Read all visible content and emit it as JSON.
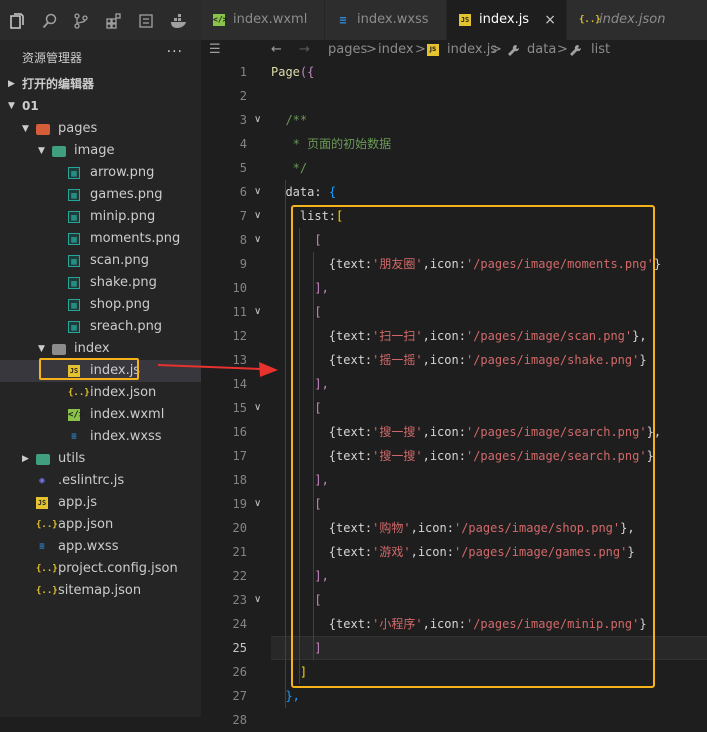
{
  "activity_bar": {
    "icons": [
      "files-icon",
      "search-icon",
      "source-control-icon",
      "extensions-icon",
      "debug-icon",
      "docker-icon"
    ]
  },
  "explorer": {
    "title": "资源管理器",
    "more": "···",
    "sections": [
      {
        "label": "打开的编辑器",
        "collapsed": true
      },
      {
        "label": "01",
        "collapsed": false
      }
    ],
    "tree": [
      {
        "name": "pages",
        "type": "folder",
        "depth": 1,
        "open": true
      },
      {
        "name": "image",
        "type": "folder-g",
        "depth": 2,
        "open": true
      },
      {
        "name": "arrow.png",
        "type": "img",
        "depth": 3
      },
      {
        "name": "games.png",
        "type": "img",
        "depth": 3
      },
      {
        "name": "minip.png",
        "type": "img",
        "depth": 3
      },
      {
        "name": "moments.png",
        "type": "img",
        "depth": 3
      },
      {
        "name": "scan.png",
        "type": "img",
        "depth": 3
      },
      {
        "name": "shake.png",
        "type": "img",
        "depth": 3
      },
      {
        "name": "shop.png",
        "type": "img",
        "depth": 3
      },
      {
        "name": "sreach.png",
        "type": "img",
        "depth": 3
      },
      {
        "name": "index",
        "type": "folder-p",
        "depth": 2,
        "open": true
      },
      {
        "name": "index.js",
        "type": "js",
        "depth": 3,
        "selected": true
      },
      {
        "name": "index.json",
        "type": "json",
        "depth": 3
      },
      {
        "name": "index.wxml",
        "type": "wxml",
        "depth": 3
      },
      {
        "name": "index.wxss",
        "type": "wxss",
        "depth": 3
      },
      {
        "name": "utils",
        "type": "folder-g",
        "depth": 1,
        "open": false
      },
      {
        "name": ".eslintrc.js",
        "type": "eslint",
        "depth": 1
      },
      {
        "name": "app.js",
        "type": "js",
        "depth": 1
      },
      {
        "name": "app.json",
        "type": "json",
        "depth": 1
      },
      {
        "name": "app.wxss",
        "type": "wxss",
        "depth": 1
      },
      {
        "name": "project.config.json",
        "type": "json",
        "depth": 1
      },
      {
        "name": "sitemap.json",
        "type": "json",
        "depth": 1
      }
    ]
  },
  "tabs": [
    {
      "label": "index.wxml",
      "icon": "wxml",
      "active": false
    },
    {
      "label": "index.wxss",
      "icon": "wxss",
      "active": false
    },
    {
      "label": "index.js",
      "icon": "js",
      "active": true,
      "close": "×"
    },
    {
      "label": "index.json",
      "icon": "json",
      "active": false,
      "italic": true
    }
  ],
  "breadcrumb": {
    "parts": [
      "pages",
      ">",
      "index",
      ">",
      "index.js",
      ">",
      "data",
      ">",
      "list"
    ]
  },
  "editor": {
    "current_line": 25,
    "lines": [
      {
        "n": "1",
        "fold": "",
        "tokens": [
          [
            "Page",
            "k-y"
          ],
          [
            "({",
            "k-p"
          ]
        ]
      },
      {
        "n": "2",
        "fold": "",
        "tokens": []
      },
      {
        "n": "3",
        "fold": "v",
        "tokens": [
          [
            "  /**",
            "k-g"
          ]
        ]
      },
      {
        "n": "4",
        "fold": "",
        "tokens": [
          [
            "   * 页面的初始数据",
            "k-g"
          ]
        ]
      },
      {
        "n": "5",
        "fold": "",
        "tokens": [
          [
            "   */",
            "k-g"
          ]
        ]
      },
      {
        "n": "6",
        "fold": "v",
        "tokens": [
          [
            "  data",
            "k-w"
          ],
          [
            ": ",
            "k-w"
          ],
          [
            "{",
            "k-b"
          ]
        ]
      },
      {
        "n": "7",
        "fold": "v",
        "tokens": [
          [
            "    list",
            "k-w"
          ],
          [
            ":",
            "k-w"
          ],
          [
            "[",
            "k-o"
          ]
        ]
      },
      {
        "n": "8",
        "fold": "v",
        "tokens": [
          [
            "      [",
            "k-p"
          ]
        ]
      },
      {
        "n": "9",
        "fold": "",
        "tokens": [
          [
            "        {text:",
            "k-w"
          ],
          [
            "'朋友圈'",
            "k-r"
          ],
          [
            ",icon:",
            "k-w"
          ],
          [
            "'/pages/image/moments.png'",
            "k-r"
          ],
          [
            "}",
            "k-w"
          ]
        ]
      },
      {
        "n": "10",
        "fold": "",
        "tokens": [
          [
            "      ],",
            "k-p"
          ]
        ]
      },
      {
        "n": "11",
        "fold": "v",
        "tokens": [
          [
            "      [",
            "k-p"
          ]
        ]
      },
      {
        "n": "12",
        "fold": "",
        "tokens": [
          [
            "        {text:",
            "k-w"
          ],
          [
            "'扫一扫'",
            "k-r"
          ],
          [
            ",icon:",
            "k-w"
          ],
          [
            "'/pages/image/scan.png'",
            "k-r"
          ],
          [
            "},",
            "k-w"
          ]
        ]
      },
      {
        "n": "13",
        "fold": "",
        "tokens": [
          [
            "        {text:",
            "k-w"
          ],
          [
            "'摇一摇'",
            "k-r"
          ],
          [
            ",icon:",
            "k-w"
          ],
          [
            "'/pages/image/shake.png'",
            "k-r"
          ],
          [
            "}",
            "k-w"
          ]
        ]
      },
      {
        "n": "14",
        "fold": "",
        "tokens": [
          [
            "      ],",
            "k-p"
          ]
        ]
      },
      {
        "n": "15",
        "fold": "v",
        "tokens": [
          [
            "      [",
            "k-p"
          ]
        ]
      },
      {
        "n": "16",
        "fold": "",
        "tokens": [
          [
            "        {text:",
            "k-w"
          ],
          [
            "'搜一搜'",
            "k-r"
          ],
          [
            ",icon:",
            "k-w"
          ],
          [
            "'/pages/image/search.png'",
            "k-r"
          ],
          [
            "},",
            "k-w"
          ]
        ]
      },
      {
        "n": "17",
        "fold": "",
        "tokens": [
          [
            "        {text:",
            "k-w"
          ],
          [
            "'搜一搜'",
            "k-r"
          ],
          [
            ",icon:",
            "k-w"
          ],
          [
            "'/pages/image/search.png'",
            "k-r"
          ],
          [
            "}",
            "k-w"
          ]
        ]
      },
      {
        "n": "18",
        "fold": "",
        "tokens": [
          [
            "      ],",
            "k-p"
          ]
        ]
      },
      {
        "n": "19",
        "fold": "v",
        "tokens": [
          [
            "      [",
            "k-p"
          ]
        ]
      },
      {
        "n": "20",
        "fold": "",
        "tokens": [
          [
            "        {text:",
            "k-w"
          ],
          [
            "'购物'",
            "k-r"
          ],
          [
            ",icon:",
            "k-w"
          ],
          [
            "'/pages/image/shop.png'",
            "k-r"
          ],
          [
            "},",
            "k-w"
          ]
        ]
      },
      {
        "n": "21",
        "fold": "",
        "tokens": [
          [
            "        {text:",
            "k-w"
          ],
          [
            "'游戏'",
            "k-r"
          ],
          [
            ",icon:",
            "k-w"
          ],
          [
            "'/pages/image/games.png'",
            "k-r"
          ],
          [
            "}",
            "k-w"
          ]
        ]
      },
      {
        "n": "22",
        "fold": "",
        "tokens": [
          [
            "      ],",
            "k-p"
          ]
        ]
      },
      {
        "n": "23",
        "fold": "v",
        "tokens": [
          [
            "      [",
            "k-p"
          ]
        ]
      },
      {
        "n": "24",
        "fold": "",
        "tokens": [
          [
            "        {text:",
            "k-w"
          ],
          [
            "'小程序'",
            "k-r"
          ],
          [
            ",icon:",
            "k-w"
          ],
          [
            "'/pages/image/minip.png'",
            "k-r"
          ],
          [
            "}",
            "k-w"
          ]
        ]
      },
      {
        "n": "25",
        "fold": "",
        "tokens": [
          [
            "      ]",
            "k-p"
          ]
        ]
      },
      {
        "n": "26",
        "fold": "",
        "tokens": [
          [
            "    ]",
            "k-o"
          ]
        ]
      },
      {
        "n": "27",
        "fold": "",
        "tokens": [
          [
            "  },",
            "k-b"
          ]
        ]
      },
      {
        "n": "28",
        "fold": "",
        "tokens": []
      }
    ]
  },
  "colors": {
    "highlight_box": "#f5b21a",
    "arrow": "#e8322e"
  }
}
